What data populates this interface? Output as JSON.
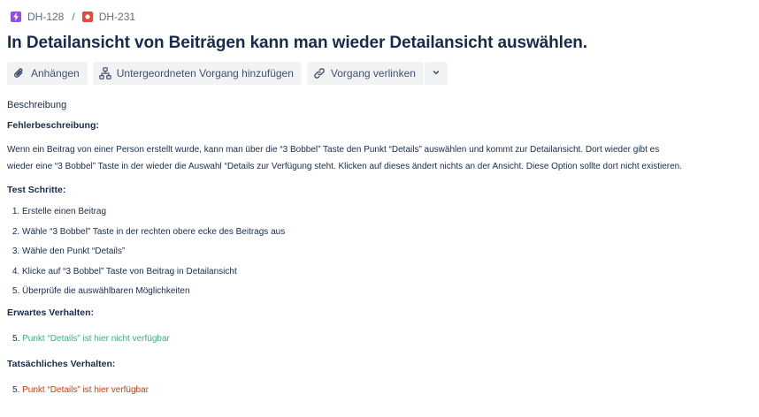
{
  "breadcrumb": {
    "parent": {
      "key": "DH-128",
      "icon": "lightning-icon",
      "color": "#904ee2"
    },
    "separator": "/",
    "current": {
      "key": "DH-231",
      "icon": "bug-icon",
      "color": "#e5493a"
    }
  },
  "issue": {
    "title": "In Detailansicht von Beiträgen kann man wieder Detailansicht auswählen."
  },
  "toolbar": {
    "attach_label": "Anhängen",
    "subtask_label": "Untergeordneten Vorgang hinzufügen",
    "link_label": "Vorgang verlinken"
  },
  "description": {
    "label": "Beschreibung",
    "bug_heading": "Fehlerbeschreibung:",
    "bug_text_line1": "Wenn ein Beitrag von einer Person erstellt wurde, kann man über die “3 Bobbel” Taste den Punkt “Details” auswählen und kommt zur Detailansicht. Dort wieder gibt es",
    "bug_text_line2": "wieder eine “3 Bobbel” Taste in der wieder die Auswahl “Details zur Verfügung steht. Klicken auf dieses ändert nichts an der Ansicht. Diese Option sollte dort nicht existieren.",
    "steps_heading": "Test Schritte:",
    "steps": [
      "Erstelle einen Beitrag",
      "Wähle “3 Bobbel” Taste in der rechten obere ecke des Beitrags aus",
      "Wähle den Punkt “Details”",
      "Klicke auf “3 Bobbel” Taste von Beitrag in Detailansicht",
      "Überprüfe die auswählbaren Möglichkeiten"
    ],
    "expected_heading": "Erwartes Verhalten:",
    "expected_number": "5",
    "expected_text": "Punkt “Details” ist hier nicht verfügbar",
    "expected_color": "#36b37e",
    "actual_heading": "Tatsächliches Verhalten:",
    "actual_number": "5",
    "actual_text": "Punkt “Details” ist hier verfügbar",
    "actual_color": "#de350b"
  }
}
